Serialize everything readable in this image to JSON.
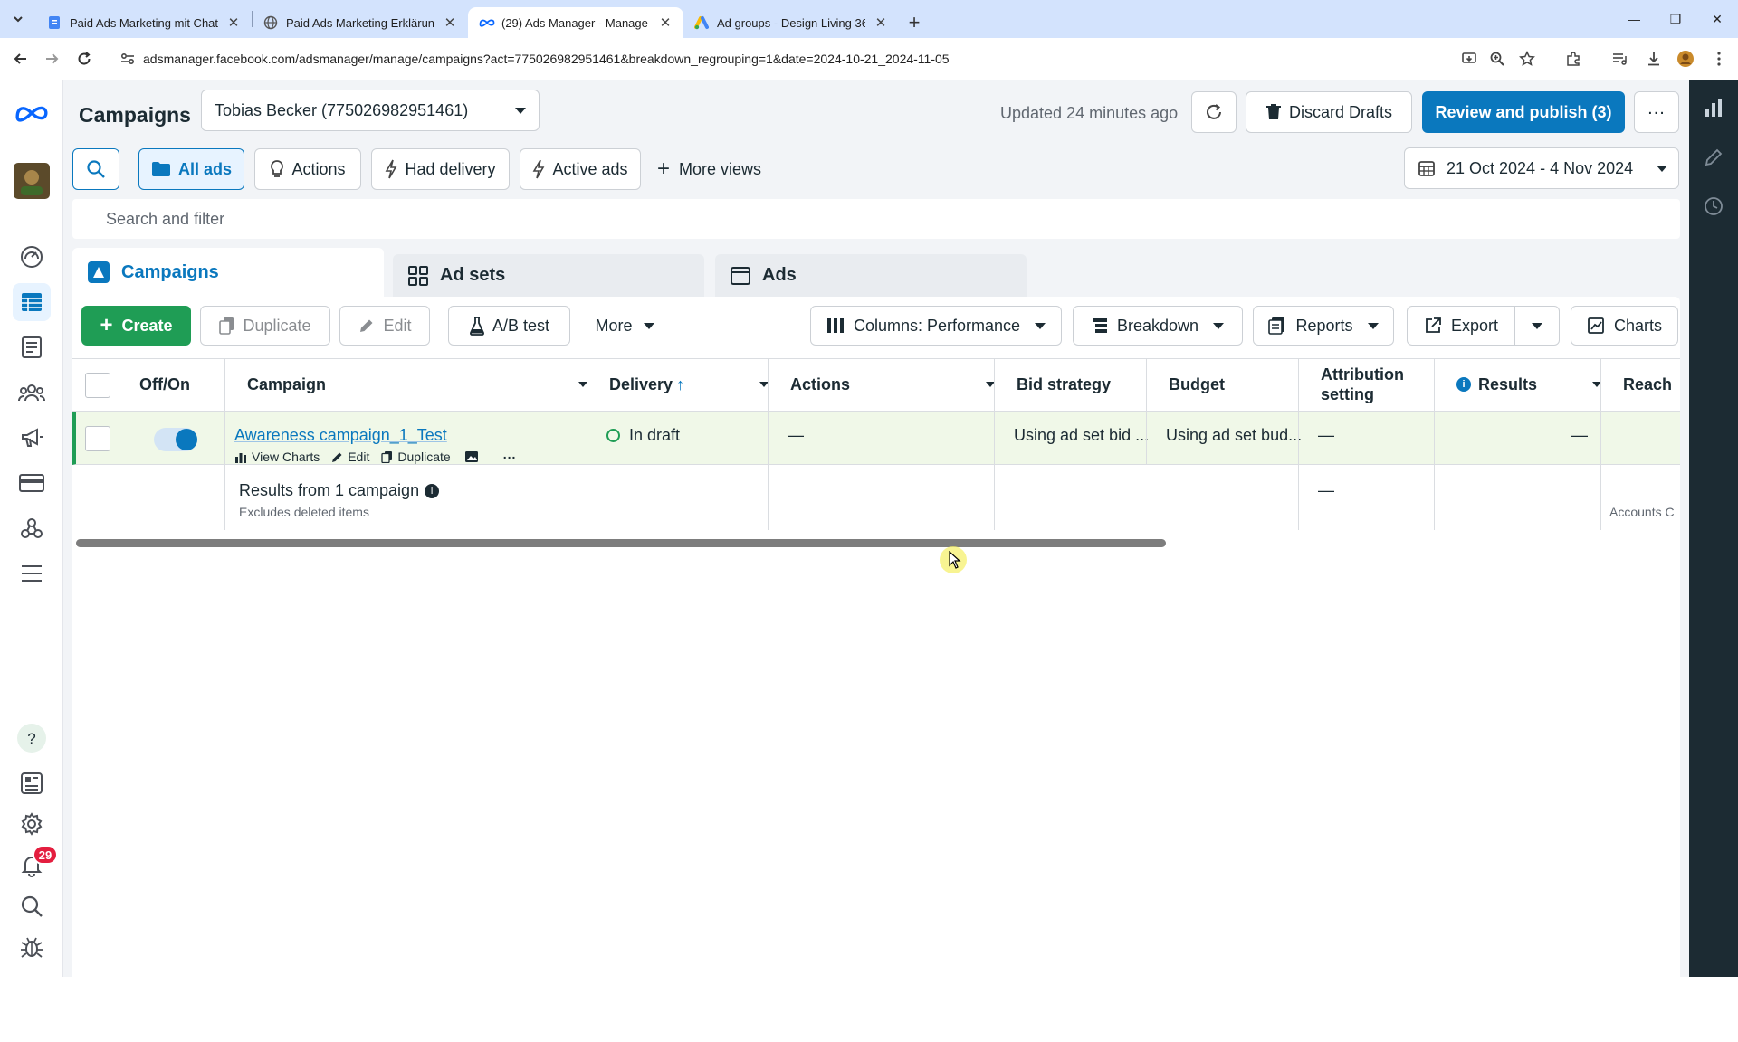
{
  "browser": {
    "tabs": [
      {
        "title": "Paid Ads Marketing mit ChatGP",
        "icon": "doc-icon",
        "active": false
      },
      {
        "title": "Paid Ads Marketing Erklärung",
        "icon": "globe-icon",
        "active": false
      },
      {
        "title": "(29) Ads Manager - Manage ad",
        "icon": "meta-icon",
        "active": true
      },
      {
        "title": "Ad groups - Design Living 365",
        "icon": "google-ads-icon",
        "active": false
      }
    ],
    "url": "adsmanager.facebook.com/adsmanager/manage/campaigns?act=775026982951461&breakdown_regrouping=1&date=2024-10-21_2024-11-05"
  },
  "header": {
    "title": "Campaigns",
    "account_selector": "Tobias Becker (775026982951461)",
    "updated_text": "Updated 24 minutes ago",
    "discard_label": "Discard Drafts",
    "review_label": "Review and publish (3)"
  },
  "views": {
    "all_ads": "All ads",
    "actions": "Actions",
    "had_delivery": "Had delivery",
    "active_ads": "Active ads",
    "more_views": "More views",
    "date_range": "21 Oct 2024 - 4 Nov 2024"
  },
  "search": {
    "placeholder": "Search and filter"
  },
  "level_tabs": {
    "campaigns": "Campaigns",
    "ad_sets": "Ad sets",
    "ads": "Ads"
  },
  "toolbar": {
    "create": "Create",
    "duplicate": "Duplicate",
    "edit": "Edit",
    "ab_test": "A/B test",
    "more": "More",
    "columns": "Columns: Performance",
    "breakdown": "Breakdown",
    "reports": "Reports",
    "export": "Export",
    "charts": "Charts"
  },
  "table": {
    "headers": {
      "off_on": "Off/On",
      "campaign": "Campaign",
      "delivery": "Delivery",
      "actions": "Actions",
      "bid_strategy": "Bid strategy",
      "budget": "Budget",
      "attribution_line1": "Attribution",
      "attribution_line2": "setting",
      "results": "Results",
      "reach": "Reach"
    },
    "row": {
      "campaign_name": "Awareness campaign_1_Test",
      "toggle_on": true,
      "view_charts": "View Charts",
      "edit": "Edit",
      "duplicate": "Duplicate",
      "delivery": "In draft",
      "actions": "—",
      "bid_strategy": "Using ad set bid ...",
      "budget": "Using ad set bud...",
      "attribution": "—",
      "results": "—"
    },
    "summary": {
      "title": "Results from 1 campaign",
      "subtitle": "Excludes deleted items",
      "attribution": "—",
      "reach": "Accounts C"
    }
  },
  "leftnav": {
    "notification_count": "29"
  }
}
